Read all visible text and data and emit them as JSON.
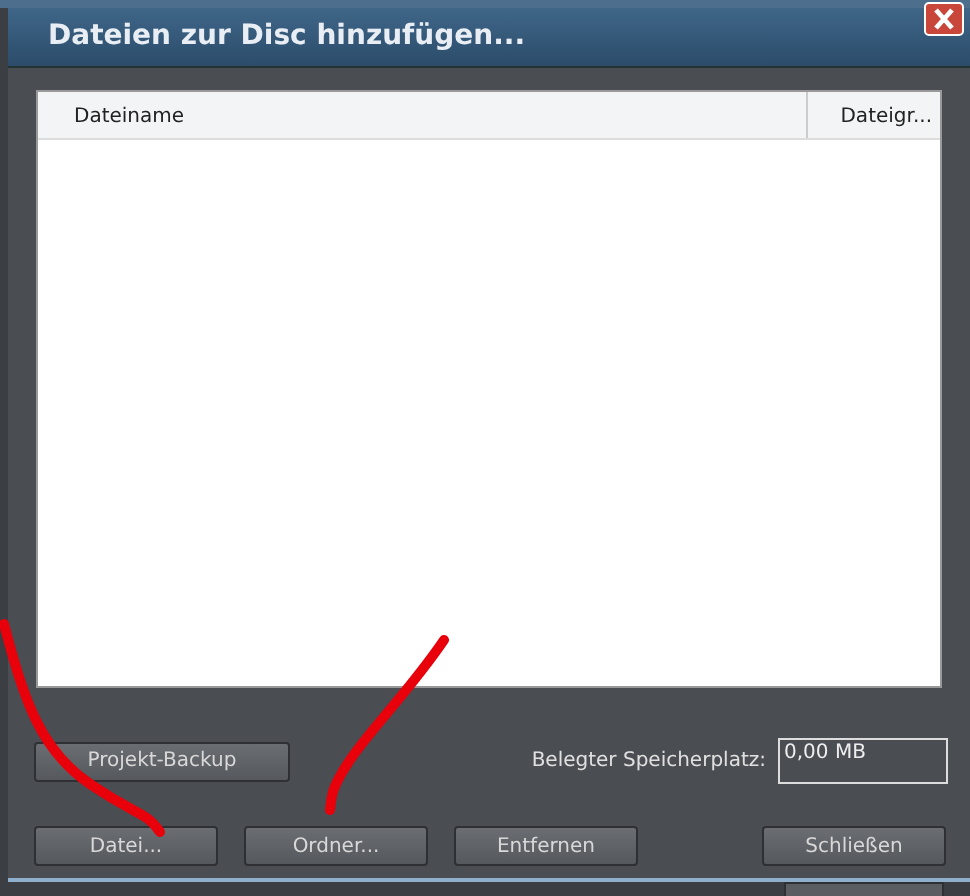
{
  "window": {
    "title": "Dateien zur Disc hinzufügen..."
  },
  "file_list": {
    "columns": [
      "Dateiname",
      "Dateigr..."
    ]
  },
  "backup_button": "Projekt-Backup",
  "used_space": {
    "label": "Belegter Speicherplatz:",
    "value": "0,00 MB"
  },
  "buttons": [
    "Datei...",
    "Ordner...",
    "Entfernen",
    "Schließen"
  ]
}
